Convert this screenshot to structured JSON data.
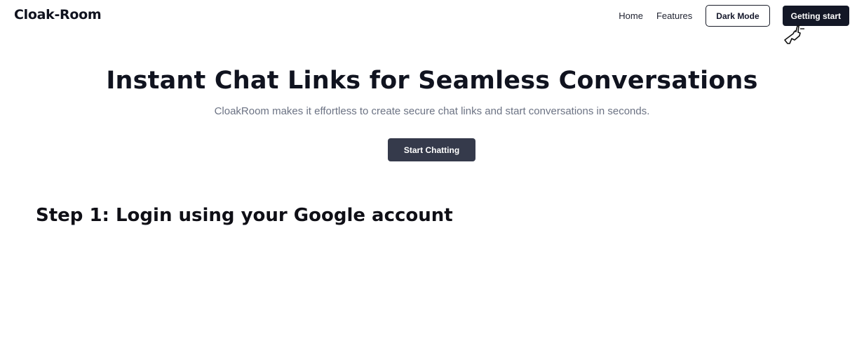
{
  "header": {
    "logo": "Cloak-Room",
    "nav": {
      "home": "Home",
      "features": "Features",
      "dark_mode": "Dark Mode",
      "getting_start": "Getting start"
    }
  },
  "hero": {
    "title": "Instant Chat Links for Seamless Conversations",
    "subtitle": "CloakRoom makes it effortless to create secure chat links and start conversations in seconds.",
    "cta": "Start Chatting"
  },
  "step": {
    "caption": "Step 1: Login using your Google account"
  },
  "icons": {
    "cursor": "hand-pointer-click-icon"
  },
  "colors": {
    "primary_dark": "#131726",
    "cta_bg": "#353a4b",
    "subtitle": "#6c7384",
    "background": "#ffffff"
  }
}
